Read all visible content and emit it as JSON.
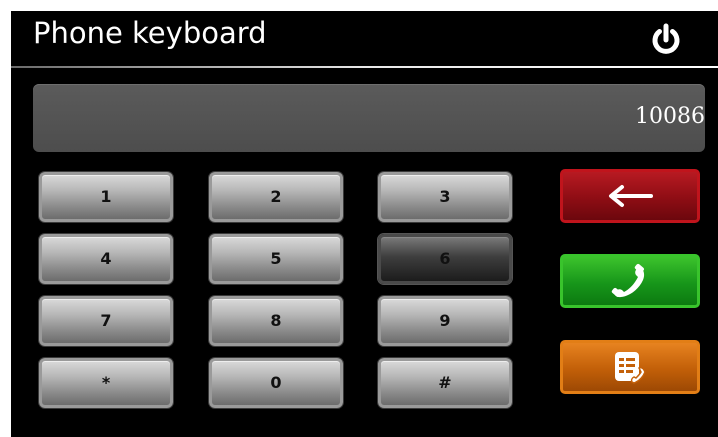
{
  "header": {
    "title": "Phone keyboard",
    "power_icon": "power-icon"
  },
  "display": {
    "number": "10086"
  },
  "keypad": {
    "keys": [
      {
        "label": "1"
      },
      {
        "label": "2"
      },
      {
        "label": "3"
      },
      {
        "label": "4"
      },
      {
        "label": "5"
      },
      {
        "label": "6",
        "pressed": true
      },
      {
        "label": "7"
      },
      {
        "label": "8"
      },
      {
        "label": "9"
      },
      {
        "label": "*"
      },
      {
        "label": "0"
      },
      {
        "label": "#"
      }
    ]
  },
  "actions": {
    "backspace": {
      "icon": "arrow-left-icon",
      "color": "#a0121a"
    },
    "call": {
      "icon": "phone-handset-icon",
      "color": "#1f9e1f"
    },
    "contacts": {
      "icon": "contact-book-icon",
      "color": "#d06a0e"
    }
  },
  "colors": {
    "background": "#000000",
    "display_background": "#555555",
    "key_face": "#b7b7b7",
    "key_pressed": "#2a2a2a",
    "text_primary": "#ffffff"
  }
}
